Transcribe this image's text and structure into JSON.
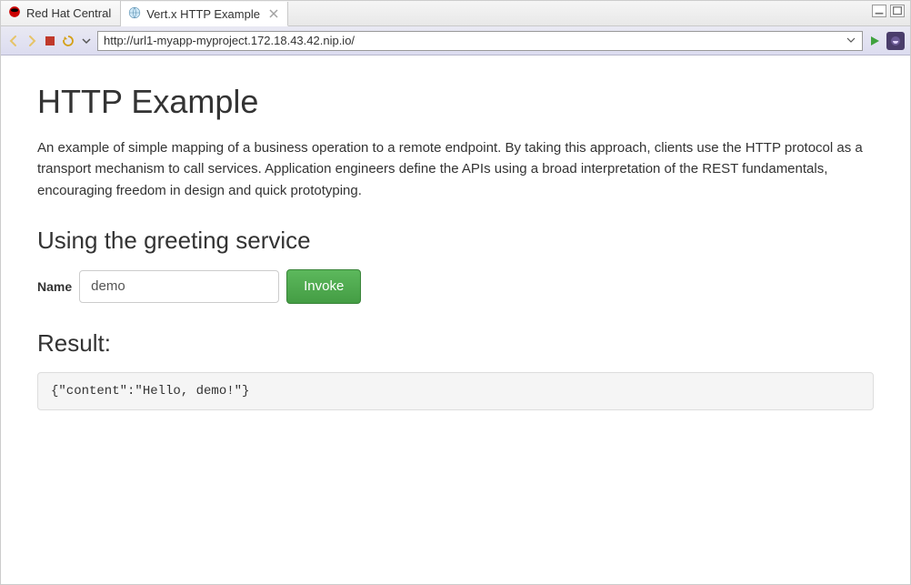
{
  "tabs": [
    {
      "label": "Red Hat Central",
      "active": false
    },
    {
      "label": "Vert.x HTTP Example",
      "active": true
    }
  ],
  "toolbar": {
    "url": "http://url1-myapp-myproject.172.18.43.42.nip.io/"
  },
  "page": {
    "heading": "HTTP Example",
    "description": "An example of simple mapping of a business operation to a remote endpoint. By taking this approach, clients use the HTTP protocol as a transport mechanism to call services. Application engineers define the APIs using a broad interpretation of the REST fundamentals, encouraging freedom in design and quick prototyping.",
    "section_heading": "Using the greeting service",
    "form": {
      "name_label": "Name",
      "name_value": "demo",
      "invoke_label": "Invoke"
    },
    "result_heading": "Result:",
    "result_body": "{\"content\":\"Hello, demo!\"}"
  }
}
